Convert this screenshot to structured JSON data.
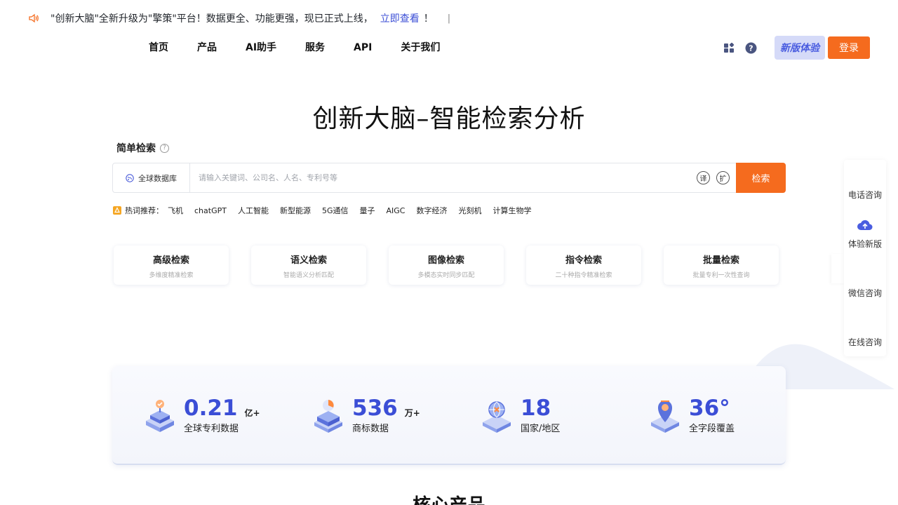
{
  "notice": {
    "text": "\"创新大脑\"全新升级为\"擎策\"平台！数据更全、功能更强，现已正式上线，",
    "link": "立即查看",
    "after": "！",
    "caret": "|"
  },
  "nav": {
    "items": [
      "首页",
      "产品",
      "AI助手",
      "服务",
      "API",
      "关于我们"
    ]
  },
  "header": {
    "new_label": "新版体验",
    "login_label": "登录",
    "help_glyph": "?"
  },
  "hero": {
    "title": "创新大脑–智能检索分析"
  },
  "search": {
    "label": "简单检索",
    "help_glyph": "?",
    "db_label": "全球数据库",
    "placeholder": "请输入关键词、公司名、人名、专利号等",
    "translate_glyph": "译",
    "expand_glyph": "扩",
    "button_label": "检索"
  },
  "hot": {
    "label": "热词推荐：",
    "items": [
      "飞机",
      "chatGPT",
      "人工智能",
      "新型能源",
      "5G通信",
      "量子",
      "AIGC",
      "数字经济",
      "光刻机",
      "计算生物学"
    ]
  },
  "cards": [
    {
      "title": "高级检索",
      "sub": "多维度精准检索"
    },
    {
      "title": "语义检索",
      "sub": "智能语义分析匹配"
    },
    {
      "title": "图像检索",
      "sub": "多模态实时同步匹配"
    },
    {
      "title": "指令检索",
      "sub": "二十种指令精准检索"
    },
    {
      "title": "批量检索",
      "sub": "批量专利一次性查询"
    }
  ],
  "side": {
    "phone": "电话咨询",
    "new": "体验新版",
    "wechat": "微信咨询",
    "online": "在线咨询"
  },
  "stats": [
    {
      "num": "0.21",
      "unit": "亿+",
      "label": "全球专利数据"
    },
    {
      "num": "536",
      "unit": "万+",
      "label": "商标数据"
    },
    {
      "num": "18",
      "unit": "",
      "label": "国家/地区"
    },
    {
      "num": "36°",
      "unit": "",
      "label": "全字段覆盖"
    }
  ],
  "section": {
    "core_title": "核心产品"
  },
  "colors": {
    "accent_orange": "#f56b1e",
    "accent_blue": "#3b4ed6",
    "new_bg": "#d5daf8"
  },
  "icons": [
    "speaker-icon",
    "apps-grid-icon",
    "help-circle-icon",
    "globe-icon",
    "cloud-upload-icon",
    "fire-icon"
  ]
}
